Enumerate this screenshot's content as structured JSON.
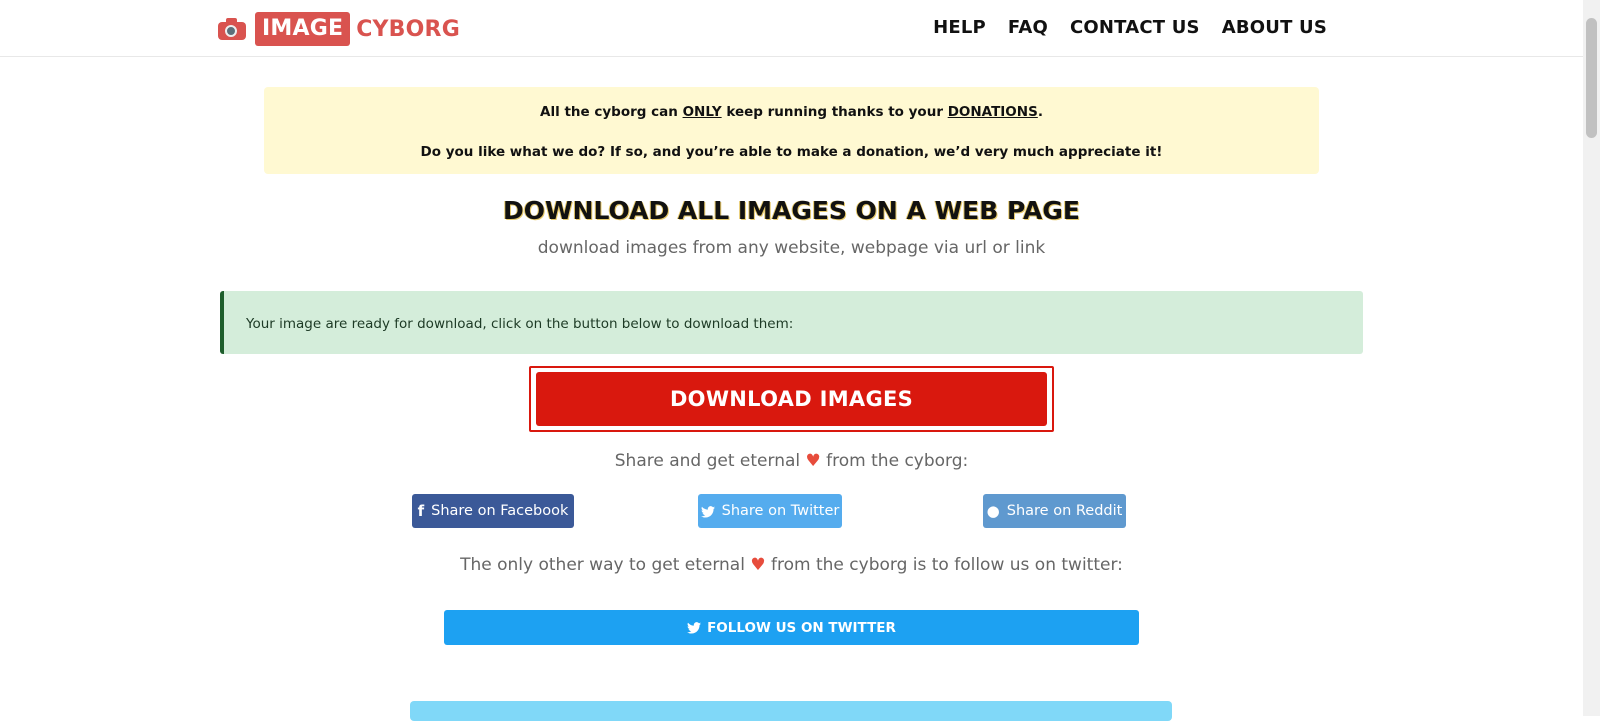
{
  "header": {
    "logo_boxed": "IMAGE",
    "logo_word": "CYBORG",
    "nav": [
      "HELP",
      "FAQ",
      "CONTACT US",
      "ABOUT US"
    ]
  },
  "donation": {
    "line1_pre": "All the cyborg can ",
    "line1_only": "ONLY",
    "line1_mid": " keep running thanks to your ",
    "line1_link": "DONATIONS",
    "line1_post": ".",
    "line2": "Do you like what we do? If so, and you’re able to make a donation, we’d very much appreciate it!"
  },
  "main": {
    "title": "DOWNLOAD ALL IMAGES ON A WEB PAGE",
    "subtitle": "download images from any website, webpage via url or link",
    "alert": "Your image are ready for download, click on the button below to download them:",
    "download_label": "DOWNLOAD IMAGES",
    "share_pre": "Share and get eternal ",
    "share_post": " from the cyborg:",
    "heart": "♥",
    "share_buttons": {
      "facebook": "Share on Facebook",
      "twitter": "Share on Twitter",
      "reddit": "Share on Reddit"
    },
    "follow_pre": "The only other way to get eternal ",
    "follow_post": " from the cyborg is to follow us on twitter:",
    "follow_label": "FOLLOW US ON TWITTER"
  },
  "colors": {
    "brand_red": "#d9534f",
    "download_red": "#d9180e",
    "facebook": "#3b5998",
    "twitter": "#55acee",
    "reddit": "#5f99cf",
    "follow_blue": "#1da1f2"
  },
  "icons": {
    "logo": "camera-icon",
    "facebook": "facebook-icon",
    "twitter": "twitter-icon",
    "reddit": "reddit-icon"
  }
}
